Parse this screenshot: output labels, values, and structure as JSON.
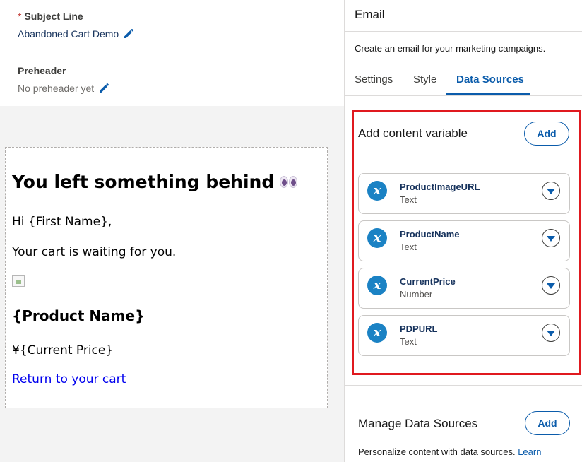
{
  "subject": {
    "label": "Subject Line",
    "required_mark": "*",
    "value": "Abandoned Cart Demo"
  },
  "preheader": {
    "label": "Preheader",
    "value": "No preheader yet"
  },
  "email_preview": {
    "heading": "You left something behind",
    "heading_emoji": "eyes-emoji",
    "greeting": "Hi {First Name},",
    "message": "Your cart is waiting for you.",
    "product_name": "{Product Name}",
    "price": "¥{Current Price}",
    "link_text": "Return to your cart"
  },
  "panel": {
    "title": "Email",
    "description": "Create an email for your marketing campaigns.",
    "tabs": [
      {
        "label": "Settings",
        "active": false
      },
      {
        "label": "Style",
        "active": false
      },
      {
        "label": "Data Sources",
        "active": true
      }
    ]
  },
  "content_variables": {
    "title": "Add content variable",
    "add_label": "Add",
    "items": [
      {
        "name": "ProductImageURL",
        "type": "Text"
      },
      {
        "name": "ProductName",
        "type": "Text"
      },
      {
        "name": "CurrentPrice",
        "type": "Number"
      },
      {
        "name": "PDPURL",
        "type": "Text"
      }
    ]
  },
  "data_sources": {
    "title": "Manage Data Sources",
    "add_label": "Add",
    "description": "Personalize content with data sources.",
    "learn_link": "Learn"
  },
  "colors": {
    "accent": "#0b5cab",
    "highlight_border": "#e0191f",
    "variable_icon": "#1b82c4",
    "link": "#0000ee"
  }
}
